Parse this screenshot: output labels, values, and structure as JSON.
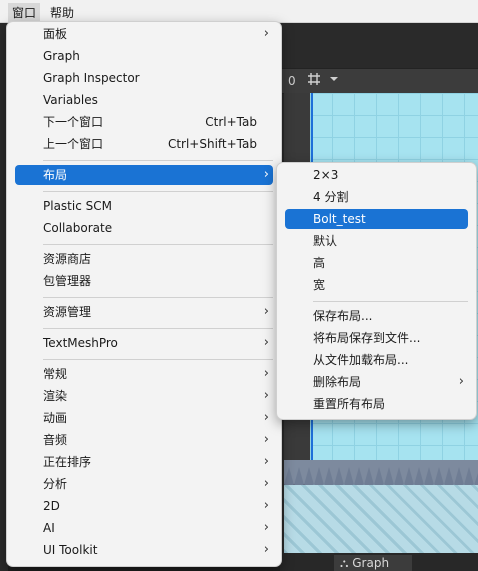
{
  "menubar": {
    "items": [
      {
        "label": "窗口",
        "active": true
      },
      {
        "label": "帮助",
        "active": false
      }
    ]
  },
  "editor": {
    "toolbar_text": "0",
    "status_tab_label": "Graph"
  },
  "main_menu": {
    "items": [
      {
        "label": "面板",
        "shortcut": "",
        "submenu": true
      },
      {
        "label": "Graph",
        "shortcut": "",
        "submenu": false
      },
      {
        "label": "Graph Inspector",
        "shortcut": "",
        "submenu": false
      },
      {
        "label": "Variables",
        "shortcut": "",
        "submenu": false
      },
      {
        "label": "下一个窗口",
        "shortcut": "Ctrl+Tab",
        "submenu": false
      },
      {
        "label": "上一个窗口",
        "shortcut": "Ctrl+Shift+Tab",
        "submenu": false
      },
      {
        "label": "布局",
        "shortcut": "",
        "submenu": true,
        "highlighted": true
      },
      {
        "label": "Plastic SCM",
        "shortcut": "",
        "submenu": false
      },
      {
        "label": "Collaborate",
        "shortcut": "",
        "submenu": false
      },
      {
        "label": "资源商店",
        "shortcut": "",
        "submenu": false
      },
      {
        "label": "包管理器",
        "shortcut": "",
        "submenu": false
      },
      {
        "label": "资源管理",
        "shortcut": "",
        "submenu": true
      },
      {
        "label": "TextMeshPro",
        "shortcut": "",
        "submenu": true
      },
      {
        "label": "常规",
        "shortcut": "",
        "submenu": true
      },
      {
        "label": "渲染",
        "shortcut": "",
        "submenu": true
      },
      {
        "label": "动画",
        "shortcut": "",
        "submenu": true
      },
      {
        "label": "音频",
        "shortcut": "",
        "submenu": true
      },
      {
        "label": "正在排序",
        "shortcut": "",
        "submenu": true
      },
      {
        "label": "分析",
        "shortcut": "",
        "submenu": true
      },
      {
        "label": "2D",
        "shortcut": "",
        "submenu": true
      },
      {
        "label": "AI",
        "shortcut": "",
        "submenu": true
      },
      {
        "label": "UI Toolkit",
        "shortcut": "",
        "submenu": true
      }
    ]
  },
  "layout_submenu": {
    "items": [
      {
        "label": "2×3",
        "submenu": false
      },
      {
        "label": "4 分割",
        "submenu": false
      },
      {
        "label": "Bolt_test",
        "submenu": false,
        "highlighted": true
      },
      {
        "label": "默认",
        "submenu": false
      },
      {
        "label": "高",
        "submenu": false
      },
      {
        "label": "宽",
        "submenu": false
      },
      {
        "label": "保存布局...",
        "submenu": false
      },
      {
        "label": "将布局保存到文件...",
        "submenu": false
      },
      {
        "label": "从文件加载布局...",
        "submenu": false
      },
      {
        "label": "删除布局",
        "submenu": true
      },
      {
        "label": "重置所有布局",
        "submenu": false
      }
    ]
  },
  "colors": {
    "highlight": "#1a73d4",
    "menu_background": "#f3f3f3",
    "scene_sky": "#a6e3f0"
  },
  "icons": {
    "submenu_arrow": "chevron-right-icon",
    "grid_tool": "grid-icon",
    "dropdown": "chevron-down-icon",
    "graph_tab": "graph-icon"
  }
}
